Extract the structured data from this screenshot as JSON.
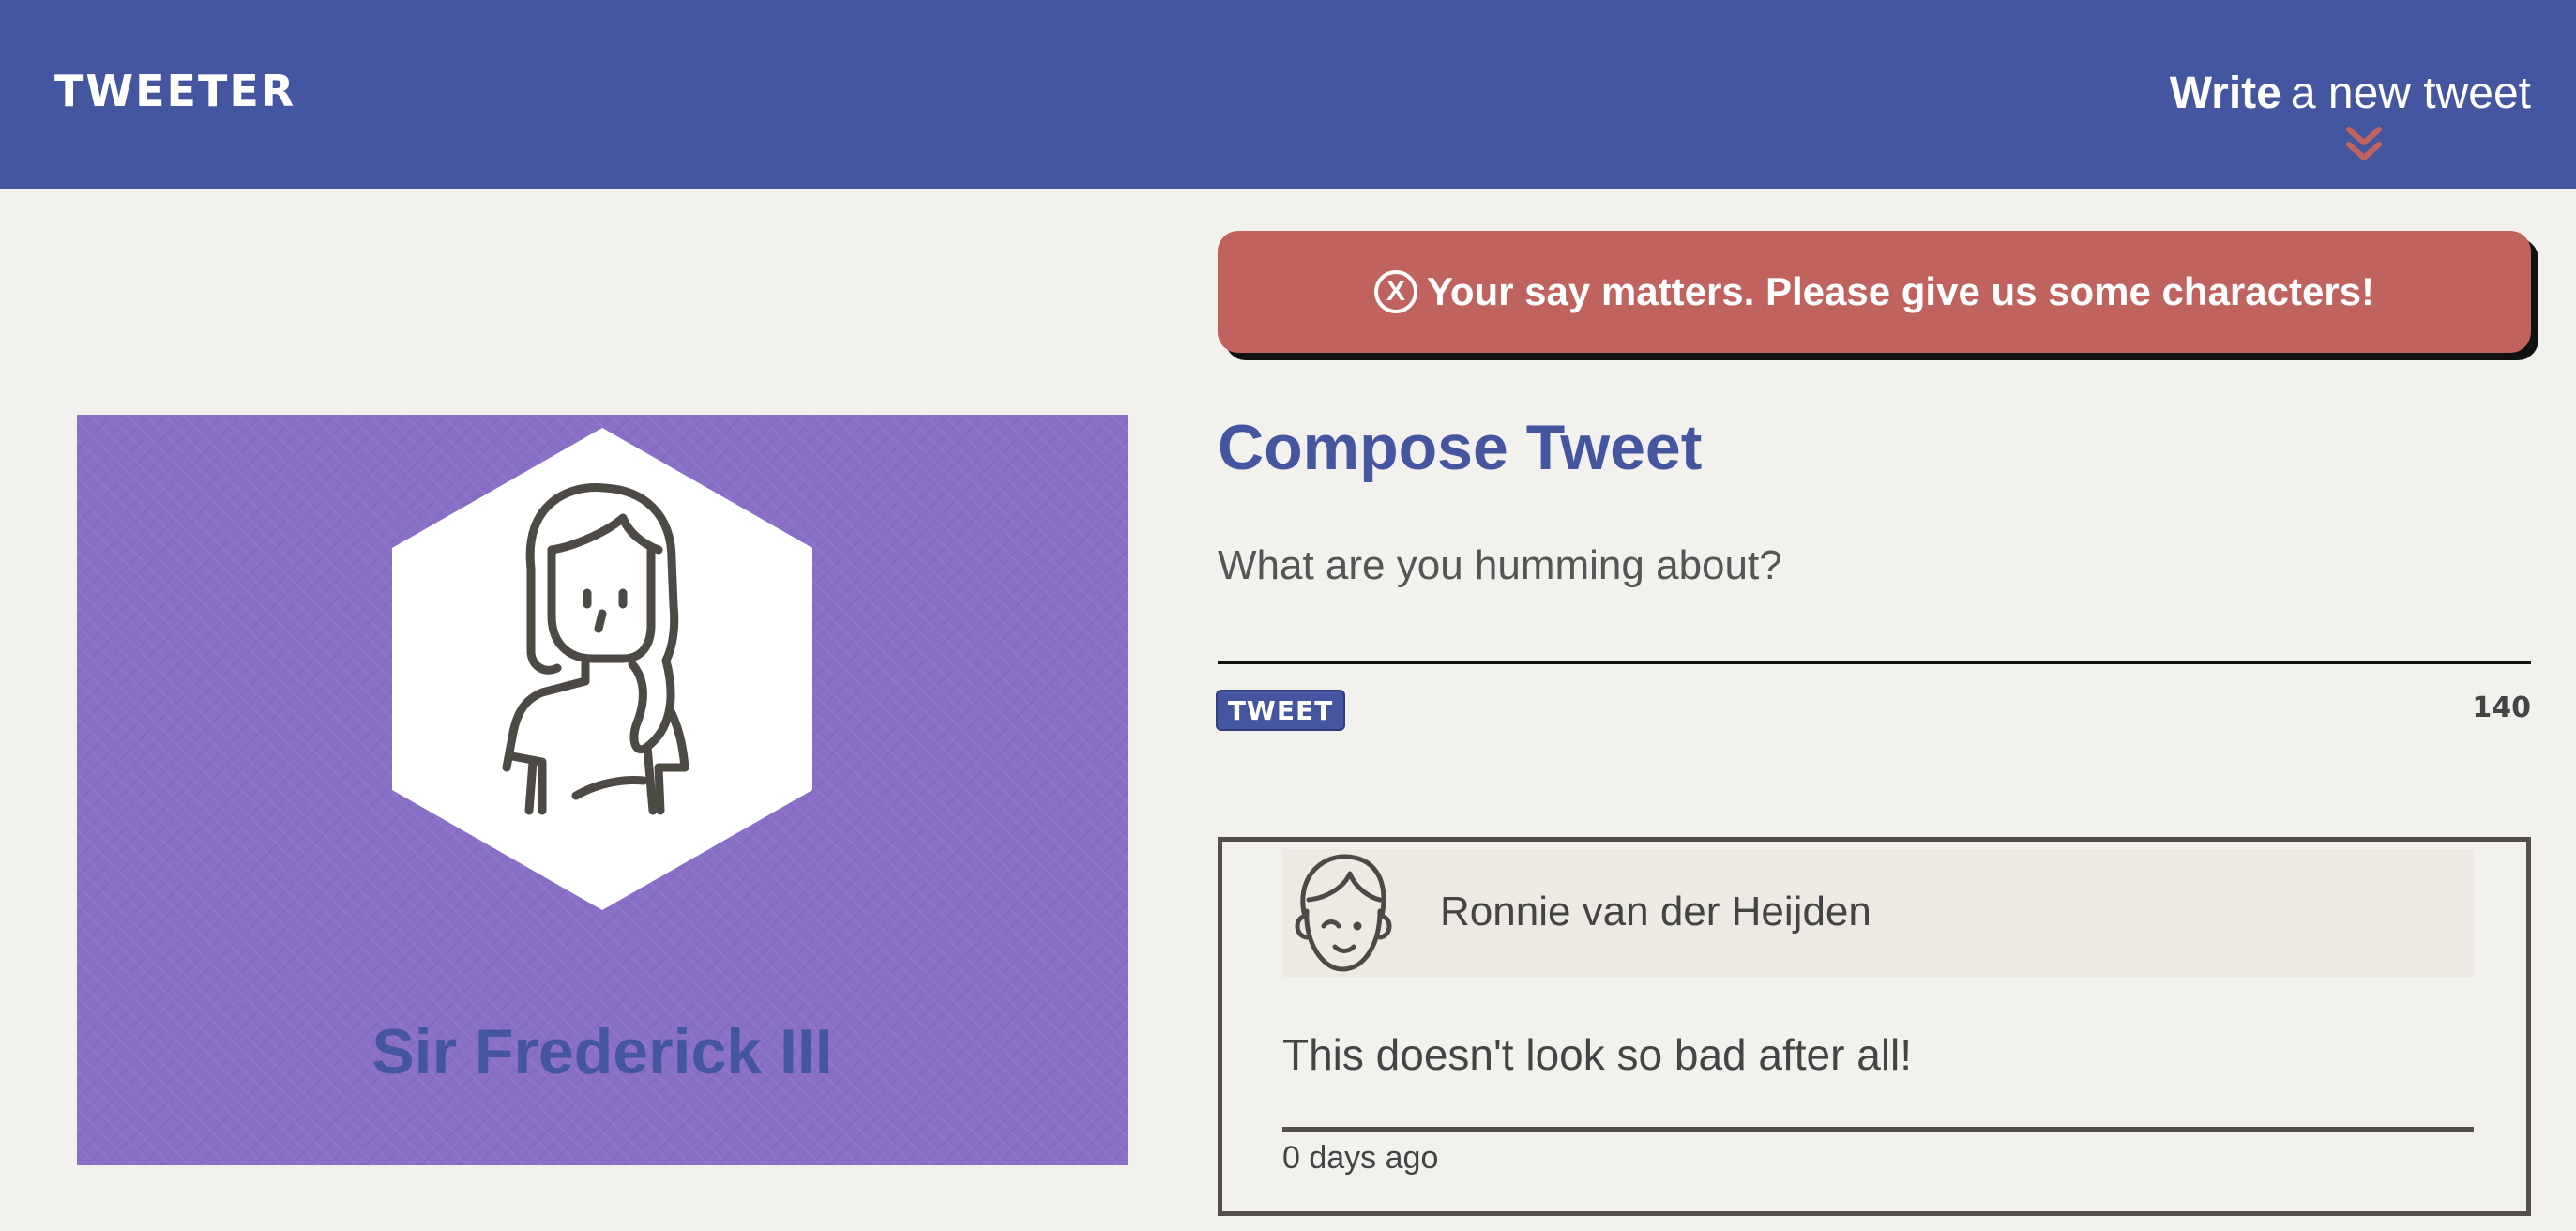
{
  "nav": {
    "brand": "TWEETER",
    "write_strong": "Write",
    "write_rest": "a new tweet",
    "chevron_icon": "double-chevron-down-icon",
    "chevron_color": "#c0625e"
  },
  "profile": {
    "name": "Sir Frederick III",
    "avatar_icon": "woman-avatar-icon"
  },
  "error": {
    "icon": "x-circle-icon",
    "icon_glyph": "X",
    "message": "Your say matters. Please give us some characters!"
  },
  "compose": {
    "title": "Compose Tweet",
    "placeholder": "What are you humming about?",
    "value": "",
    "button_label": "TWEET",
    "counter": "140"
  },
  "tweets": [
    {
      "author": "Ronnie van der Heijden",
      "avatar_icon": "boy-avatar-icon",
      "text": "This doesn't look so bad after all!",
      "time": "0 days ago"
    }
  ],
  "colors": {
    "nav_bg": "#4556a0",
    "page_bg": "#f3f1ed",
    "profile_bg": "#8a6fc7",
    "error_bg": "#c0625e",
    "accent_blue": "#4556a0",
    "border_dark": "#545049"
  }
}
